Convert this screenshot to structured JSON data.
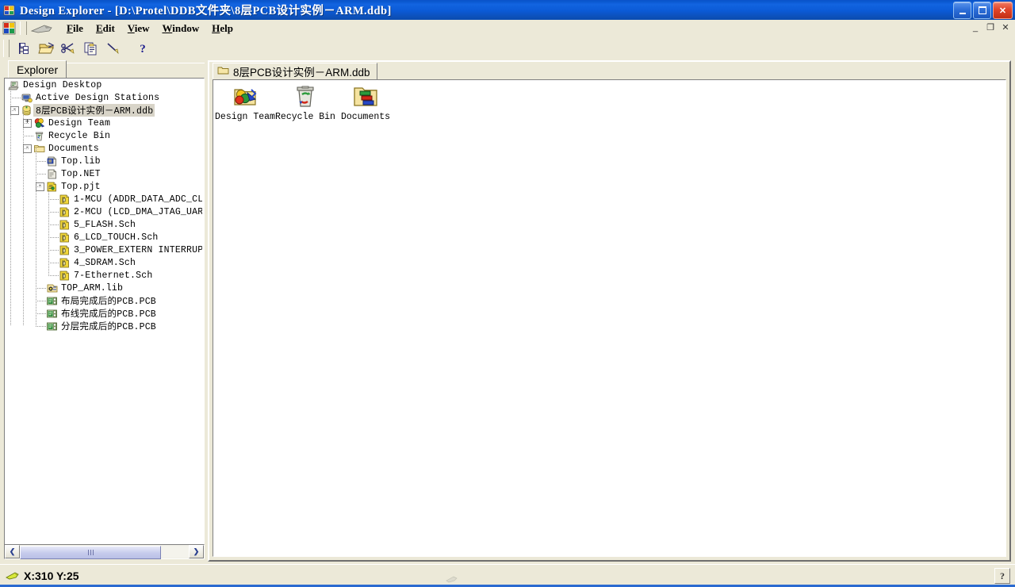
{
  "window": {
    "title": "Design Explorer - [D:\\Protel\\DDB文件夹\\8层PCB设计实例－ARM.ddb]",
    "app_icon": "protel-app-icon",
    "controls": {
      "minimize": "minimize-button",
      "restore": "restore-button",
      "close": "close-button"
    },
    "mdi_controls": {
      "minimize": "_",
      "restore": "❐",
      "close": "✕"
    }
  },
  "menubar": {
    "items": [
      {
        "label": "File",
        "accel": "F"
      },
      {
        "label": "Edit",
        "accel": "E"
      },
      {
        "label": "View",
        "accel": "V"
      },
      {
        "label": "Window",
        "accel": "W"
      },
      {
        "label": "Help",
        "accel": "H"
      }
    ]
  },
  "toolbar": {
    "buttons": [
      {
        "name": "design-explorer-toggle-icon",
        "title": "Toggle Design Explorer"
      },
      {
        "name": "open-folder-icon",
        "title": "Open"
      },
      {
        "name": "cut-icon",
        "title": "Cut"
      },
      {
        "name": "copy-icon",
        "title": "Copy"
      },
      {
        "name": "pen-icon",
        "title": "Pen"
      },
      {
        "name": "help-question-icon",
        "title": "Help"
      }
    ]
  },
  "explorer": {
    "tab_label": "Explorer",
    "scrollbar": {
      "left_arrow": "❮",
      "right_arrow": "❯"
    },
    "tree": [
      {
        "label": "Design Desktop",
        "depth": 0,
        "icon": "desktop-icon",
        "expander": null,
        "selected": false
      },
      {
        "label": "Active Design Stations",
        "depth": 1,
        "icon": "station-icon",
        "expander": null,
        "selected": false
      },
      {
        "label": "8层PCB设计实例－ARM.ddb",
        "depth": 1,
        "icon": "ddb-database-icon",
        "expander": "-",
        "selected": true
      },
      {
        "label": "Design Team",
        "depth": 2,
        "icon": "design-team-icon",
        "expander": "+",
        "selected": false
      },
      {
        "label": "Recycle Bin",
        "depth": 2,
        "icon": "recycle-bin-icon",
        "expander": null,
        "selected": false
      },
      {
        "label": "Documents",
        "depth": 2,
        "icon": "folder-icon",
        "expander": "-",
        "selected": false
      },
      {
        "label": "Top.lib",
        "depth": 3,
        "icon": "library-icon",
        "expander": null,
        "selected": false
      },
      {
        "label": "Top.NET",
        "depth": 3,
        "icon": "netlist-icon",
        "expander": null,
        "selected": false
      },
      {
        "label": "Top.pjt",
        "depth": 3,
        "icon": "project-icon",
        "expander": "-",
        "selected": false
      },
      {
        "label": "1-MCU (ADDR_DATA_ADC_CL",
        "depth": 4,
        "icon": "schematic-icon",
        "expander": null,
        "selected": false
      },
      {
        "label": "2-MCU (LCD_DMA_JTAG_UAR",
        "depth": 4,
        "icon": "schematic-icon",
        "expander": null,
        "selected": false
      },
      {
        "label": "5_FLASH.Sch",
        "depth": 4,
        "icon": "schematic-icon",
        "expander": null,
        "selected": false
      },
      {
        "label": "6_LCD_TOUCH.Sch",
        "depth": 4,
        "icon": "schematic-icon",
        "expander": null,
        "selected": false
      },
      {
        "label": "3_POWER_EXTERN INTERRUP",
        "depth": 4,
        "icon": "schematic-icon",
        "expander": null,
        "selected": false
      },
      {
        "label": "4_SDRAM.Sch",
        "depth": 4,
        "icon": "schematic-icon",
        "expander": null,
        "selected": false
      },
      {
        "label": "7-Ethernet.Sch",
        "depth": 4,
        "icon": "schematic-icon",
        "expander": null,
        "selected": false
      },
      {
        "label": "TOP_ARM.lib",
        "depth": 3,
        "icon": "pcblib-icon",
        "expander": null,
        "selected": false
      },
      {
        "label": "布局完成后的PCB.PCB",
        "depth": 3,
        "icon": "pcb-icon",
        "expander": null,
        "selected": false
      },
      {
        "label": "布线完成后的PCB.PCB",
        "depth": 3,
        "icon": "pcb-icon",
        "expander": null,
        "selected": false
      },
      {
        "label": "分层完成后的PCB.PCB",
        "depth": 3,
        "icon": "pcb-icon",
        "expander": null,
        "selected": false
      }
    ]
  },
  "document": {
    "tab_label": "8层PCB设计实例－ARM.ddb",
    "tab_icon": "folder-icon",
    "items": [
      {
        "label": "Design Team",
        "icon": "design-team-icon"
      },
      {
        "label": "Recycle Bin",
        "icon": "recycle-bin-icon"
      },
      {
        "label": "Documents",
        "icon": "documents-folder-icon"
      }
    ]
  },
  "statusbar": {
    "coordinates": "X:310 Y:25",
    "cursor_icon": "cursor-icon",
    "help_glyph": "?"
  },
  "colors": {
    "title_bar": "#0b57cc",
    "face": "#ece9d8",
    "selection": "#d8d4c8",
    "client": "#ffffff",
    "accent_blue": "#2a6ad0",
    "close_red": "#c22f14"
  }
}
